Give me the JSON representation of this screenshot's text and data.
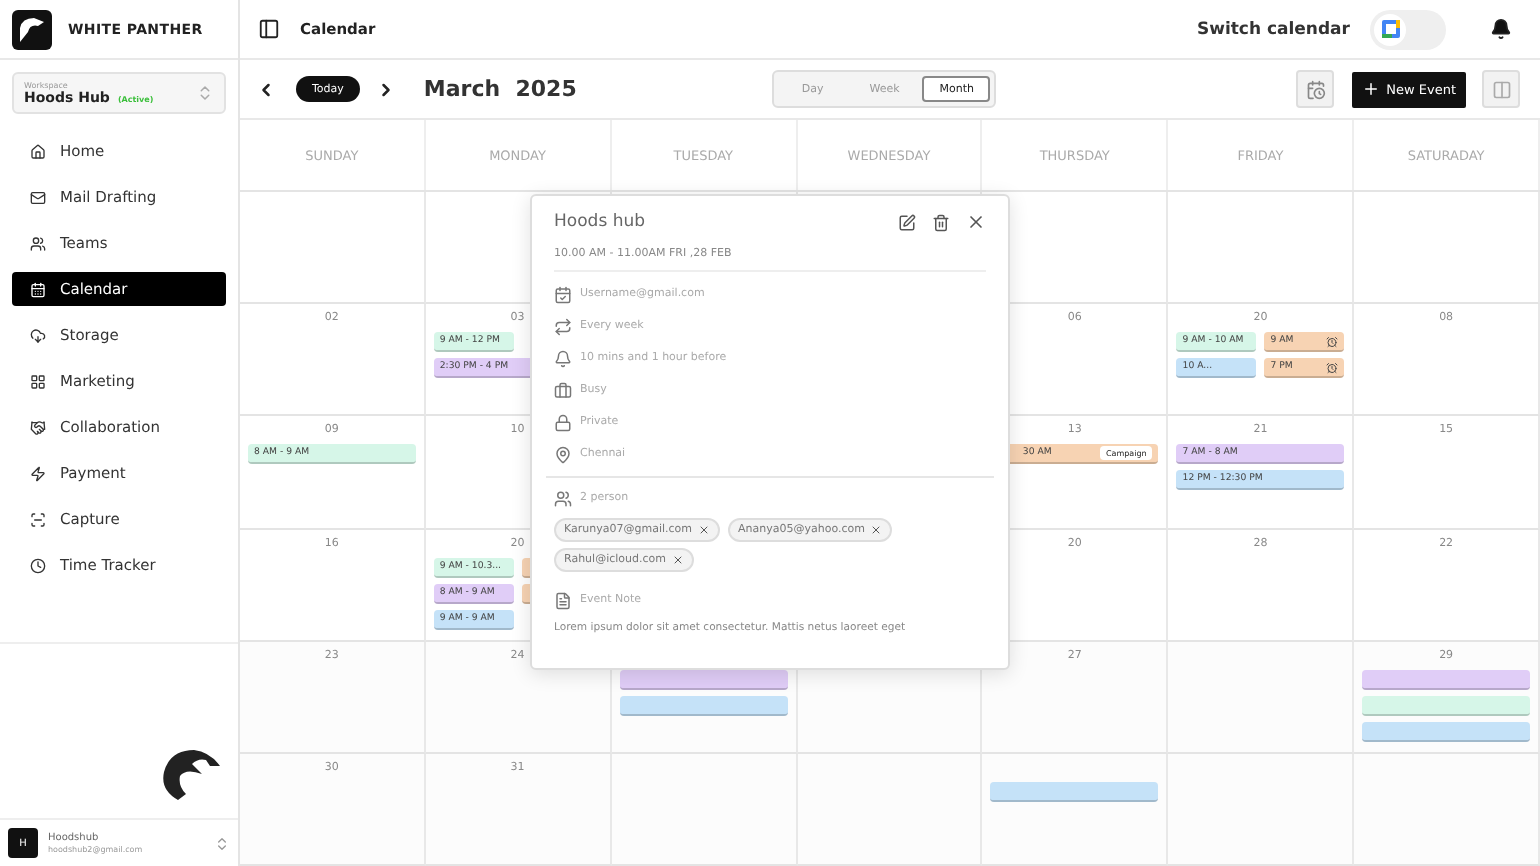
{
  "brand": "WHITE PANTHER",
  "workspace": {
    "label": "Workspace",
    "name": "Hoods Hub",
    "status": "(Active)"
  },
  "nav": [
    {
      "label": "Home",
      "selected": false
    },
    {
      "label": "Mail Drafting",
      "selected": false
    },
    {
      "label": "Teams",
      "selected": false
    },
    {
      "label": "Calendar",
      "selected": true
    },
    {
      "label": "Storage",
      "selected": false
    },
    {
      "label": "Marketing",
      "selected": false
    },
    {
      "label": "Collaboration",
      "selected": false
    },
    {
      "label": "Payment",
      "selected": false
    },
    {
      "label": "Capture",
      "selected": false
    },
    {
      "label": "Time Tracker",
      "selected": false
    }
  ],
  "account": {
    "avatar": "H",
    "name": "Hoodshub",
    "email": "hoodshub2@gmail.com"
  },
  "header": {
    "title": "Calendar",
    "switch_label": "Switch calendar",
    "switch_on": false
  },
  "toolbar": {
    "today": "Today",
    "month": "March  2025",
    "new_event": "New Event",
    "views": [
      {
        "label": "Day",
        "selected": false
      },
      {
        "label": "Week",
        "selected": false
      },
      {
        "label": "Month",
        "selected": true
      }
    ]
  },
  "weekdays": [
    "SUNDAY",
    "MONDAY",
    "TUESDAY",
    "WEDNESDAY",
    "THURSDAY",
    "FRIDAY",
    "SATURADAY"
  ],
  "weeks": [
    {
      "sunday": {
        "date": "02"
      },
      "monday": {
        "date": "03",
        "events": [
          {
            "label": "9 AM - 12 PM",
            "color": "#d6f6e8",
            "kind": "half"
          },
          {
            "label": "2:30 PM - 4 PM",
            "color": "#e0cdf7",
            "kind": "full"
          }
        ]
      },
      "thursday": {
        "date": "06"
      },
      "friday": {
        "date": "20",
        "events": [
          {
            "label": "9 AM - 10 AM",
            "color": "#d6f6e8",
            "kind": "half"
          },
          {
            "label": "9 AM",
            "color": "#f7d3b3",
            "kind": "half",
            "reminder": true
          },
          {
            "label": "10 A...",
            "color": "#c5e2f8",
            "kind": "half"
          },
          {
            "label": "7 PM",
            "color": "#f7d3b3",
            "kind": "half",
            "reminder": true
          }
        ]
      },
      "saturday": {
        "date": "08"
      }
    },
    {
      "sunday": {
        "date": "09",
        "events": [
          {
            "label": "8 AM - 9 AM",
            "color": "#d6f6e8",
            "kind": "full"
          }
        ]
      },
      "monday": {
        "date": "10"
      },
      "thursday": {
        "date": "13",
        "events": [
          {
            "label": "30 AM",
            "color": "#f7d3b3",
            "kind": "full",
            "tag": "Campaign"
          }
        ]
      },
      "friday": {
        "date": "21",
        "events": [
          {
            "label": "7 AM - 8 AM",
            "color": "#e0cdf7",
            "kind": "full"
          },
          {
            "label": "12 PM - 12:30 PM",
            "color": "#c5e2f8",
            "kind": "full"
          }
        ]
      },
      "saturday": {
        "date": "15"
      }
    },
    {
      "sunday": {
        "date": "16"
      },
      "monday": {
        "date": "20",
        "events": [
          {
            "label": "9 AM - 10.3...",
            "color": "#d6f6e8",
            "kind": "half"
          },
          {
            "color": "#f7d3b3",
            "kind": "half"
          },
          {
            "label": "8 AM - 9 AM",
            "color": "#e0cdf7",
            "kind": "half"
          },
          {
            "color": "#f7d3b3",
            "kind": "half"
          },
          {
            "label": "9 AM - 9 AM",
            "color": "#c5e2f8",
            "kind": "half"
          }
        ]
      },
      "thursday": {
        "date": "20"
      },
      "friday": {
        "date": "28"
      },
      "saturday": {
        "date": "22"
      }
    },
    {
      "sunday": {
        "date": "23"
      },
      "monday": {
        "date": "24"
      },
      "tuesday": {
        "events": [
          {
            "color": "#e0cdf7",
            "kind": "full"
          },
          {
            "color": "#c5e2f8",
            "kind": "full"
          }
        ]
      },
      "thursday": {
        "date": "27"
      },
      "saturday": {
        "date": "29",
        "events": [
          {
            "color": "#e0cdf7",
            "kind": "full"
          },
          {
            "color": "#d6f6e8",
            "kind": "full"
          },
          {
            "color": "#c5e2f8",
            "kind": "full"
          }
        ]
      }
    },
    {
      "sunday": {
        "date": "30"
      },
      "monday": {
        "date": "31"
      },
      "thursday": {
        "events": [
          {
            "color": "#c5e2f8",
            "kind": "full"
          }
        ]
      }
    }
  ],
  "popup": {
    "title": "Hoods hub",
    "time": "10.00 AM - 11.00AM",
    "date": "FRI ,28 FEB",
    "details": [
      "Username@gmail.com",
      "Every week",
      "10 mins and 1 hour before",
      "Busy",
      "Private",
      "Chennai"
    ],
    "people_count": "2 person",
    "guests": [
      "Karunya07@gmail.com",
      "Ananya05@yahoo.com",
      "Rahul@icloud.com"
    ],
    "note_label": "Event Note",
    "note": "Lorem ipsum dolor sit amet consectetur. Mattis netus laoreet eget"
  }
}
